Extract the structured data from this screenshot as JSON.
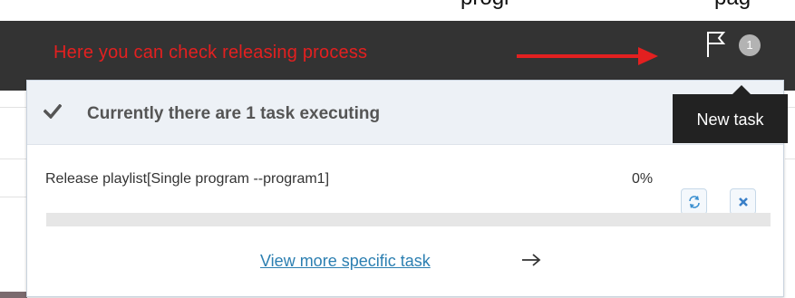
{
  "top_crop": {
    "left_fragment": "progr",
    "right_fragment": "pag"
  },
  "navbar": {
    "annotation": "Here you can check releasing process",
    "arrow_icon": "right-arrow-annotation",
    "flag_icon": "flag-icon",
    "task_count": "1"
  },
  "tooltip": {
    "text": "New task"
  },
  "dropdown": {
    "header_icon": "check-icon",
    "header_text": "Currently there are 1 task executing",
    "task": {
      "name": "Release playlist[Single program --program1]",
      "percent_text": "0%",
      "progress": 0,
      "refresh_icon": "refresh-icon",
      "cancel_icon": "close-icon"
    },
    "view_more": "View more specific task",
    "view_more_icon": "arrow-right-icon"
  },
  "colors": {
    "navbar_bg": "#333333",
    "annotation_red": "#e32020",
    "header_bg": "#edf1f6",
    "link_blue": "#2c7fb1",
    "tooltip_bg": "#222222"
  }
}
